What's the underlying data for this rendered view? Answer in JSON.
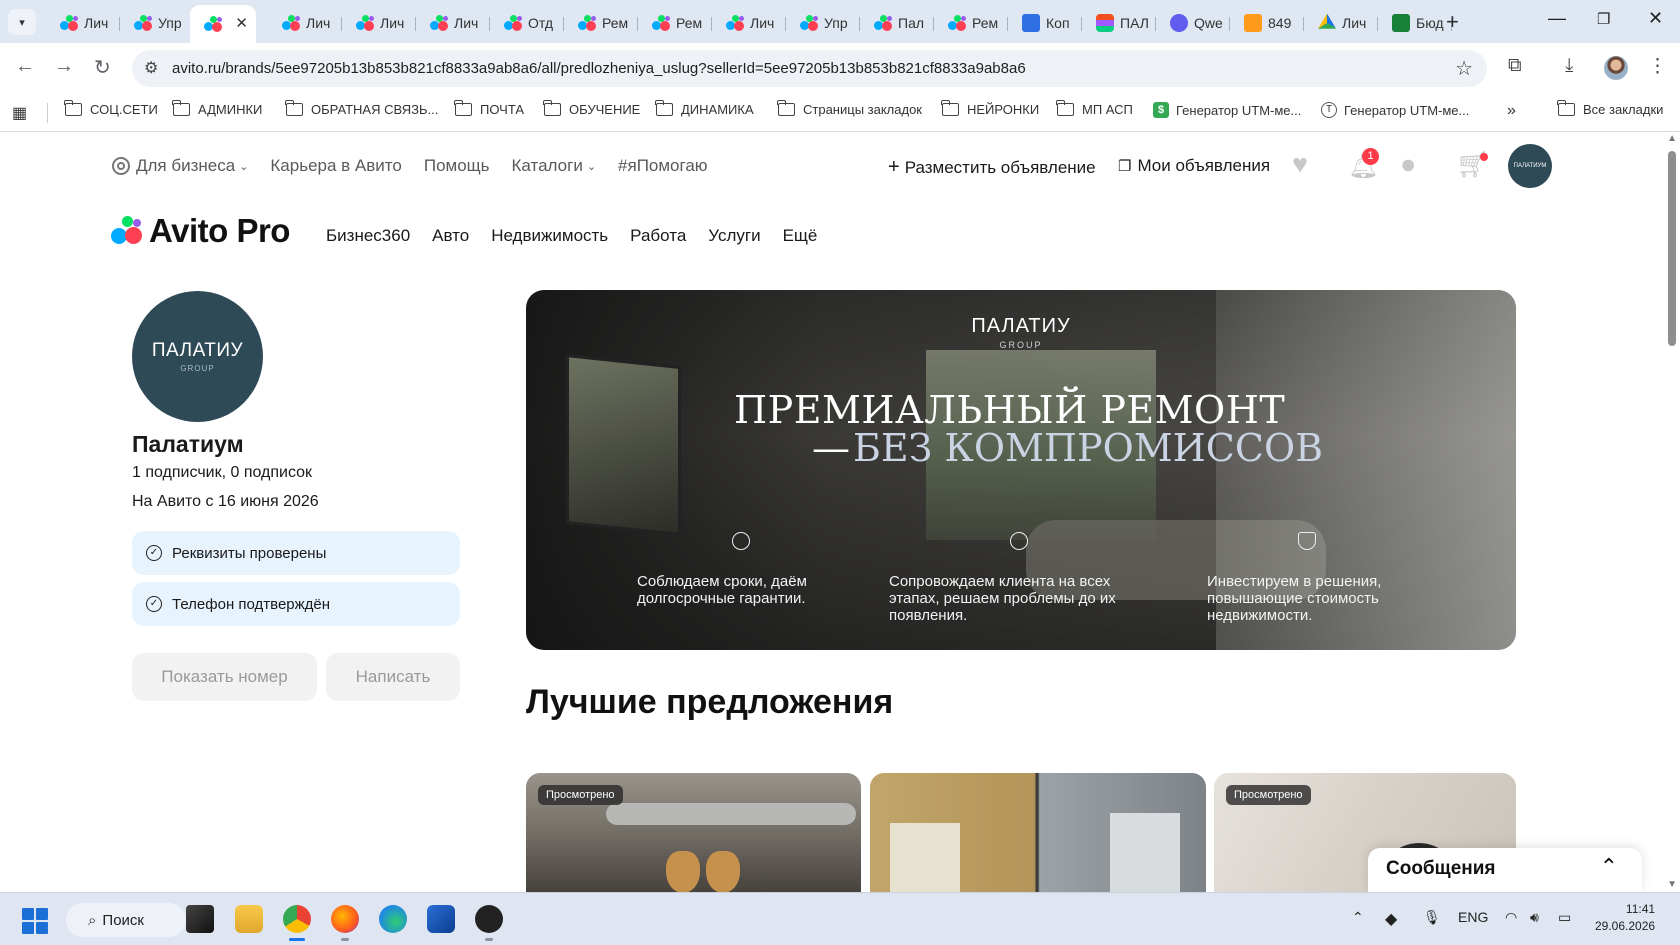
{
  "browser": {
    "tabs": [
      {
        "label": "Лич",
        "favicon": "avito"
      },
      {
        "label": "Упр",
        "favicon": "avito"
      },
      {
        "label": "",
        "favicon": "avito",
        "active": true
      },
      {
        "label": "Лич",
        "favicon": "avito"
      },
      {
        "label": "Лич",
        "favicon": "avito"
      },
      {
        "label": "Лич",
        "favicon": "avito"
      },
      {
        "label": "Отд",
        "favicon": "avito"
      },
      {
        "label": "Рем",
        "favicon": "avito"
      },
      {
        "label": "Рем",
        "favicon": "avito"
      },
      {
        "label": "Лич",
        "favicon": "avito"
      },
      {
        "label": "Упр",
        "favicon": "avito"
      },
      {
        "label": "Пал",
        "favicon": "avito"
      },
      {
        "label": "Рем",
        "favicon": "avito"
      },
      {
        "label": "Коп",
        "favicon": "docs"
      },
      {
        "label": "ПАЛ",
        "favicon": "figma"
      },
      {
        "label": "Qwe",
        "favicon": "qwen"
      },
      {
        "label": "849",
        "favicon": "mail"
      },
      {
        "label": "Лич",
        "favicon": "drive"
      },
      {
        "label": "Бюд",
        "favicon": "sheets"
      }
    ],
    "url": "avito.ru/brands/5ee97205b13b853b821cf8833a9ab8a6/all/predlozheniya_uslug?sellerId=5ee97205b13b853b821cf8833a9ab8a6",
    "bookmarks": [
      {
        "label": "СОЦ.СЕТИ",
        "icon": "folder-icon"
      },
      {
        "label": "АДМИНКИ",
        "icon": "folder-icon"
      },
      {
        "label": "ОБРАТНАЯ СВЯЗЬ...",
        "icon": "folder-icon"
      },
      {
        "label": "ПОЧТА",
        "icon": "folder-icon"
      },
      {
        "label": "ОБУЧЕНИЕ",
        "icon": "folder-icon"
      },
      {
        "label": "ДИНАМИКА",
        "icon": "folder-icon"
      },
      {
        "label": "Страницы закладок",
        "icon": "folder-icon"
      },
      {
        "label": "НЕЙРОНКИ",
        "icon": "folder-icon"
      },
      {
        "label": "МП АСП",
        "icon": "folder-icon"
      },
      {
        "label": "Генератор UTM-ме...",
        "icon": "utm-green-icon"
      },
      {
        "label": "Генератор UTM-ме...",
        "icon": "utm-circle-icon"
      }
    ],
    "all_bookmarks": "Все закладки"
  },
  "header": {
    "business": "Для бизнеса",
    "career": "Карьера в Авито",
    "help": "Помощь",
    "catalogs": "Каталоги",
    "ihelp": "#яПомогаю",
    "post_ad": "Разместить объявление",
    "my_ads": "Мои объявления",
    "notifications_count": "1",
    "avatar_text": "ПАЛАТИУМ"
  },
  "brand_nav": {
    "logo": "Avito Pro",
    "items": [
      "Бизнес360",
      "Авто",
      "Недвижимость",
      "Работа",
      "Услуги",
      "Ещё"
    ]
  },
  "seller": {
    "avatar_brand": "ПАЛАТИУ",
    "avatar_group": "GROUP",
    "name": "Палатиум",
    "subscribers": "1 подписчик, 0 подписок",
    "since": "На Авито с 16 июня 2026",
    "verify_docs": "Реквизиты проверены",
    "verify_phone": "Телефон подтверждён",
    "show_phone": "Показать номер",
    "write": "Написать"
  },
  "banner": {
    "logo": "ПАЛАТИУ",
    "logo_sub": "GROUP",
    "headline_1": "ПРЕМИАЛЬНЫЙ РЕМОНТ",
    "headline_2_dash": "—",
    "headline_2": "БЕЗ КОМПРОМИССОВ",
    "features": [
      "Соблюдаем сроки, даём долгосрочные гарантии.",
      "Сопровождаем клиента на всех этапах, решаем проблемы до их появления.",
      "Инвестируем в решения, повышающие стоимость недвижимости."
    ]
  },
  "offers": {
    "title": "Лучшие предложения",
    "badge": "Просмотрено"
  },
  "messages": {
    "title": "Сообщения"
  },
  "taskbar": {
    "search": "Поиск",
    "lang": "ENG",
    "time": "11:41",
    "date": "29.06.2026"
  },
  "colors": {
    "avito_red": "#ff4053",
    "avito_blue": "#00aaff",
    "avito_green": "#04e061",
    "avito_purple": "#965eeb",
    "seller_bg": "#2e4a56",
    "verify_bg": "#e7f3fd"
  }
}
